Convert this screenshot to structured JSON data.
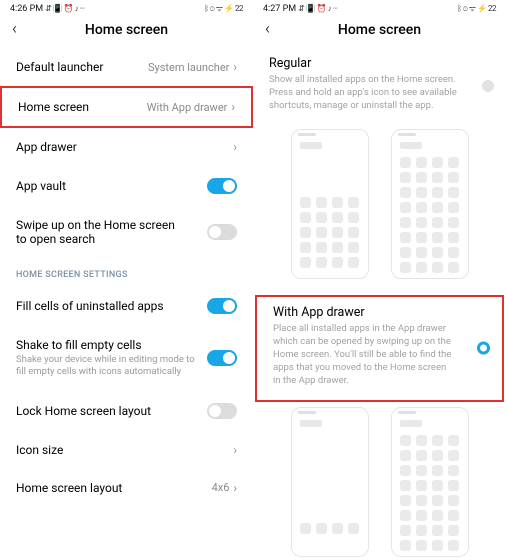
{
  "left": {
    "status": {
      "time": "4:26 PM",
      "left_icons": "⇵ 📳 ⏰ ♪ ···",
      "right_icons": "ᛒ ⊙ ᯤ ⚡ 22"
    },
    "header": {
      "title": "Home screen"
    },
    "rows": {
      "default_launcher": {
        "label": "Default launcher",
        "value": "System launcher"
      },
      "home_screen": {
        "label": "Home screen",
        "value": "With App drawer"
      },
      "app_drawer": {
        "label": "App drawer"
      },
      "app_vault": {
        "label": "App vault"
      },
      "swipe_up": {
        "label": "Swipe up on the Home screen to open search"
      }
    },
    "section": "HOME SCREEN SETTINGS",
    "settings": {
      "fill_cells": {
        "label": "Fill cells of uninstalled apps"
      },
      "shake": {
        "label": "Shake to fill empty cells",
        "sub": "Shake your device while in editing mode to fill empty cells with icons automatically"
      },
      "lock_layout": {
        "label": "Lock Home screen layout"
      },
      "icon_size": {
        "label": "Icon size"
      },
      "hs_layout": {
        "label": "Home screen layout",
        "value": "4x6"
      }
    }
  },
  "right": {
    "status": {
      "time": "4:27 PM",
      "left_icons": "⇵ 📳 ⏰ ♪ ···",
      "right_icons": "ᛒ ⊙ ᯤ ⚡ 22"
    },
    "header": {
      "title": "Home screen"
    },
    "regular": {
      "title": "Regular",
      "desc": "Show all installed apps on the Home screen. Press and hold an app's icon to see available shortcuts, manage or uninstall the app."
    },
    "with_drawer": {
      "title": "With App drawer",
      "desc": "Place all installed apps in the App drawer which can be opened by swiping up on the Home screen. You'll still be able to find the apps that you moved to the Home screen in the App drawer."
    }
  }
}
